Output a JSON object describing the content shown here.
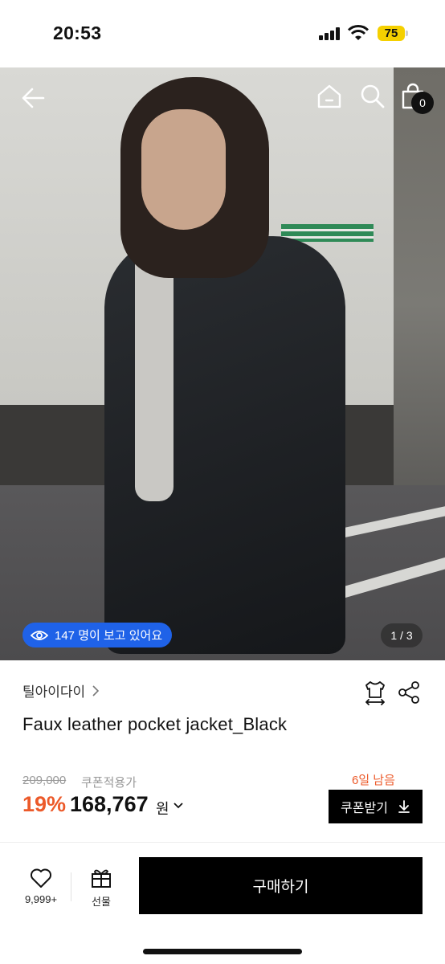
{
  "status_bar": {
    "time": "20:53",
    "battery": "75"
  },
  "hero": {
    "viewer_count_text": "147 명이 보고 있어요",
    "page_counter": "1 / 3"
  },
  "header": {
    "cart_count": "0"
  },
  "product": {
    "brand": "틸아이다이",
    "name": "Faux leather pocket jacket_Black",
    "original_price": "209,000",
    "coupon_label": "쿠폰적용가",
    "discount": "19%",
    "price": "168,767",
    "currency": "원",
    "days_left": "6일 남음",
    "coupon_button": "쿠폰받기"
  },
  "bottom_bar": {
    "like_count": "9,999+",
    "gift_label": "선물",
    "buy_label": "구매하기"
  },
  "colors": {
    "accent_orange": "#ec5a2a",
    "badge_blue": "#1f62e8",
    "battery_yellow": "#f5d000"
  },
  "icons": [
    "back-arrow-icon",
    "home-icon",
    "search-icon",
    "shopping-bag-icon",
    "eye-icon",
    "size-guide-icon",
    "share-icon",
    "download-icon",
    "heart-icon",
    "gift-icon",
    "chevron-right-icon",
    "chevron-down-icon"
  ]
}
